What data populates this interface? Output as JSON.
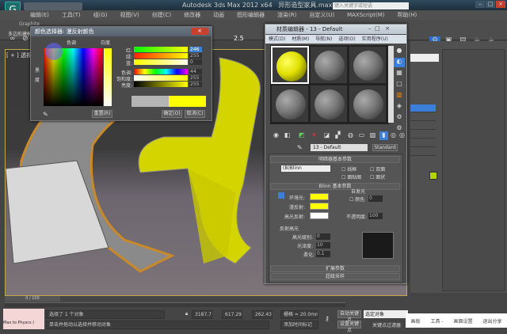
{
  "app": {
    "title": "Autodesk 3ds Max  2012 x64",
    "file": "异形造型家具.max",
    "search_placeholder": "键入关键字或短语",
    "logo": "max"
  },
  "menu": [
    "编辑(E)",
    "工具(T)",
    "组(G)",
    "视图(V)",
    "创建(C)",
    "修改器",
    "动画",
    "图形编辑器",
    "渲染(R)",
    "自定义(U)",
    "MAXScript(M)",
    "帮助(H)"
  ],
  "ribbon": {
    "graphite": "Graphite",
    "poly": "多边形建模"
  },
  "viewport": {
    "label": "[ + ] 透视 ]",
    "snap_value": "2.5"
  },
  "color_picker": {
    "title": "颜色选择器: 漫反射颜色",
    "hue_label": "色调",
    "white_label": "白度",
    "black_label": "黑",
    "degree_label": "度",
    "channels": [
      {
        "label": "红:",
        "value": "246"
      },
      {
        "label": "绿:",
        "value": "255"
      },
      {
        "label": "蓝:",
        "value": "0"
      },
      {
        "label": "色调:",
        "value": "44"
      },
      {
        "label": "饱和度:",
        "value": "255"
      },
      {
        "label": "亮度:",
        "value": "255"
      }
    ],
    "reset": "重置(R)",
    "ok": "确定(O)",
    "cancel": "取消(C)",
    "old_color": "#b4b4b4",
    "new_color": "#ffff00"
  },
  "material_editor": {
    "title": "材质编辑器 - 13 - Default",
    "menu": [
      "模式(D)",
      "材质(M)",
      "导航(N)",
      "选项(O)",
      "实用程序(U)"
    ],
    "material_name": "13 - Default",
    "material_type": "Standard",
    "shader_rollout": "明暗器基本参数",
    "shader": "(B)Blinn",
    "checks": [
      "线框",
      "双面",
      "面贴图",
      "面状"
    ],
    "blinn_rollout": "Blinn 基本参数",
    "self_illum": "自发光",
    "color_check": "颜色",
    "self_illum_value": "0",
    "ambient": "环境光:",
    "diffuse": "漫反射:",
    "specular": "高光反射:",
    "opacity_label": "不透明度:",
    "opacity": "100",
    "spec_group": "反射高光",
    "spec_level_label": "高光级别:",
    "spec_level": "0",
    "gloss_label": "光泽度:",
    "gloss": "10",
    "soften_label": "柔化:",
    "soften": "0.1",
    "ext_rollout": "扩展参数",
    "ss_rollout": "超级采样",
    "ambient_color": "#ffff00",
    "diffuse_color": "#ffff00",
    "specular_color": "#ffffff"
  },
  "command_panel": {
    "items": [
      "",
      "",
      "",
      "",
      "",
      ""
    ]
  },
  "status": {
    "selected": "选择了 1 个对象",
    "prompt": "单击并拖动以选择并移动对象",
    "x": "3187.736m",
    "y": "617.297mm",
    "z": "262.437mm",
    "grid": "栅格 = 20.0mm",
    "add_tag": "添加时间标记",
    "auto_key": "自动关键点",
    "set_key": "设置关键点",
    "selected_obj": "选定对象",
    "key_filter": "关键点过滤器",
    "timeline": "0 / 100",
    "maxscript": "Max to Physcs (",
    "overlay": [
      "画板",
      "工具 -",
      "画面设置",
      "退出分享"
    ]
  }
}
